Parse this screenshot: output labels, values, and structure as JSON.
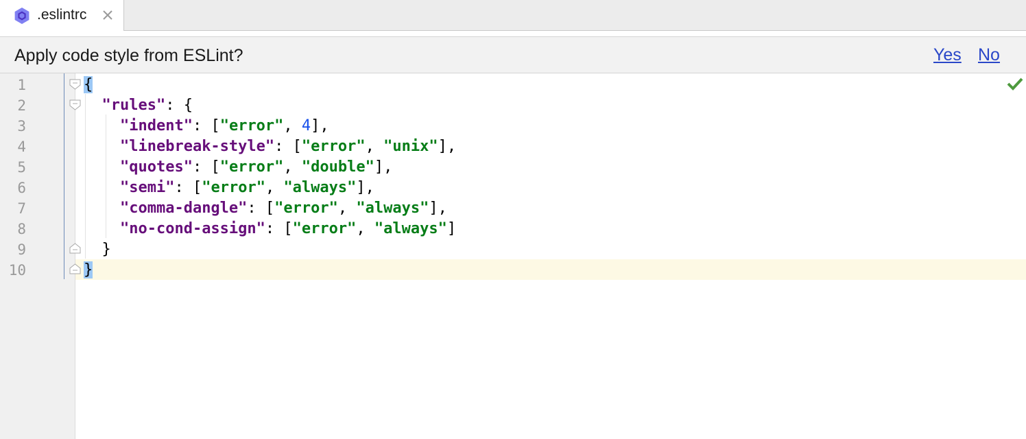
{
  "tab": {
    "label": ".eslintrc",
    "icon": "eslint-icon",
    "close_icon": "close-icon"
  },
  "notification": {
    "message": "Apply code style from ESLint?",
    "yes_label": "Yes",
    "no_label": "No"
  },
  "editor": {
    "status_icon": "checkmark-icon",
    "current_line": 10,
    "line_numbers": [
      "1",
      "2",
      "3",
      "4",
      "5",
      "6",
      "7",
      "8",
      "9",
      "10"
    ],
    "lines": [
      [
        {
          "t": "{",
          "c": "p brace-hl"
        }
      ],
      [
        {
          "t": "  ",
          "c": "p"
        },
        {
          "t": "\"rules\"",
          "c": "k"
        },
        {
          "t": ": {",
          "c": "p"
        }
      ],
      [
        {
          "t": "    ",
          "c": "p"
        },
        {
          "t": "\"indent\"",
          "c": "k"
        },
        {
          "t": ": [",
          "c": "p"
        },
        {
          "t": "\"error\"",
          "c": "s"
        },
        {
          "t": ", ",
          "c": "p"
        },
        {
          "t": "4",
          "c": "n"
        },
        {
          "t": "],",
          "c": "p"
        }
      ],
      [
        {
          "t": "    ",
          "c": "p"
        },
        {
          "t": "\"linebreak-style\"",
          "c": "k"
        },
        {
          "t": ": [",
          "c": "p"
        },
        {
          "t": "\"error\"",
          "c": "s"
        },
        {
          "t": ", ",
          "c": "p"
        },
        {
          "t": "\"unix\"",
          "c": "s"
        },
        {
          "t": "],",
          "c": "p"
        }
      ],
      [
        {
          "t": "    ",
          "c": "p"
        },
        {
          "t": "\"quotes\"",
          "c": "k"
        },
        {
          "t": ": [",
          "c": "p"
        },
        {
          "t": "\"error\"",
          "c": "s"
        },
        {
          "t": ", ",
          "c": "p"
        },
        {
          "t": "\"double\"",
          "c": "s"
        },
        {
          "t": "],",
          "c": "p"
        }
      ],
      [
        {
          "t": "    ",
          "c": "p"
        },
        {
          "t": "\"semi\"",
          "c": "k"
        },
        {
          "t": ": [",
          "c": "p"
        },
        {
          "t": "\"error\"",
          "c": "s"
        },
        {
          "t": ", ",
          "c": "p"
        },
        {
          "t": "\"always\"",
          "c": "s"
        },
        {
          "t": "],",
          "c": "p"
        }
      ],
      [
        {
          "t": "    ",
          "c": "p"
        },
        {
          "t": "\"comma-dangle\"",
          "c": "k"
        },
        {
          "t": ": [",
          "c": "p"
        },
        {
          "t": "\"error\"",
          "c": "s"
        },
        {
          "t": ", ",
          "c": "p"
        },
        {
          "t": "\"always\"",
          "c": "s"
        },
        {
          "t": "],",
          "c": "p"
        }
      ],
      [
        {
          "t": "    ",
          "c": "p"
        },
        {
          "t": "\"no-cond-assign\"",
          "c": "k"
        },
        {
          "t": ": [",
          "c": "p"
        },
        {
          "t": "\"error\"",
          "c": "s"
        },
        {
          "t": ", ",
          "c": "p"
        },
        {
          "t": "\"always\"",
          "c": "s"
        },
        {
          "t": "]",
          "c": "p"
        }
      ],
      [
        {
          "t": "  }",
          "c": "p"
        }
      ],
      [
        {
          "t": "}",
          "c": "p brace-hl"
        }
      ]
    ]
  }
}
